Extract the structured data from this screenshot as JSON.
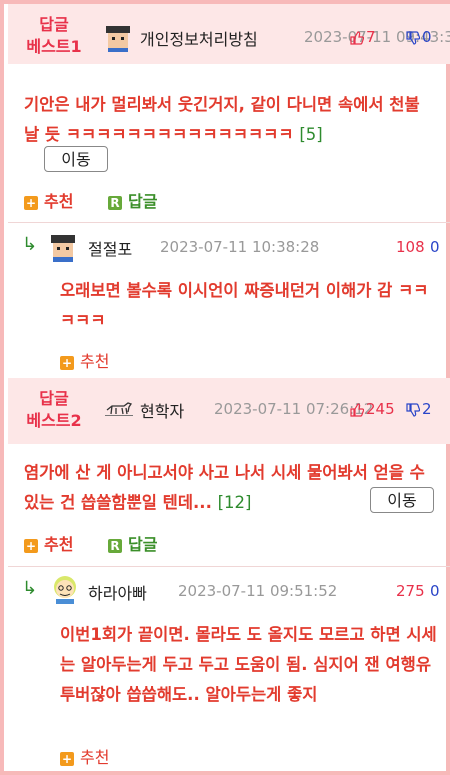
{
  "best1": {
    "badge_line1": "답글",
    "badge_line2": "베스트1",
    "nick": "개인정보처리방침",
    "datetime": "2023-07-11 09:43:3",
    "up": "7",
    "down": "0",
    "text": "기안은 내가 멀리봐서 웃긴거지, 같이 다니면 속에서 천불 날 듯 ㅋㅋㅋㅋㅋㅋㅋㅋㅋㅋㅋㅋㅋㅋㅋ",
    "reply_count": "[5]",
    "move_label": "이동",
    "recommend_label": "추천",
    "reply_label": "답글"
  },
  "reply1": {
    "nick": "절절포",
    "datetime": "2023-07-11 10:38:28",
    "up": "108",
    "down": "0",
    "text": "오래보면 볼수록 이시언이 짜증내던거 이해가 감 ㅋㅋㅋㅋㅋ",
    "recommend_label": "추천"
  },
  "best2": {
    "badge_line1": "답글",
    "badge_line2": "베스트2",
    "nick": "현학자",
    "datetime": "2023-07-11 07:26:12",
    "up": "245",
    "down": "2",
    "text": "염가에 산 게 아니고서야 사고 나서 시세 물어봐서 얻을 수 있는 건 씁쓸함뿐일 텐데...",
    "reply_count": "[12]",
    "move_label": "이동",
    "recommend_label": "추천",
    "reply_label": "답글"
  },
  "reply2": {
    "nick": "하라아빠",
    "datetime": "2023-07-11 09:51:52",
    "up": "275",
    "down": "0",
    "text": "이번1회가 끝이면. 몰라도 도 올지도 모르고 하면 시세는 알아두는게 두고 두고 도움이 됨. 심지어 잰 여행유투버잖아 씁씁해도.. 알아두는게 좋지",
    "recommend_label": "추천"
  },
  "colors": {
    "accent_red": "#e8314a",
    "body_red": "#e23b2e",
    "down_blue": "#2a45c8",
    "border_pink": "#f7b9b9",
    "header_bg": "#fde7e7"
  },
  "icons": {
    "thumbs_up": "thumbs-up-icon",
    "thumbs_down": "thumbs-down-icon",
    "plus": "plus-icon",
    "reply_r": "reply-r-icon",
    "reply_arrow": "reply-arrow-icon"
  }
}
